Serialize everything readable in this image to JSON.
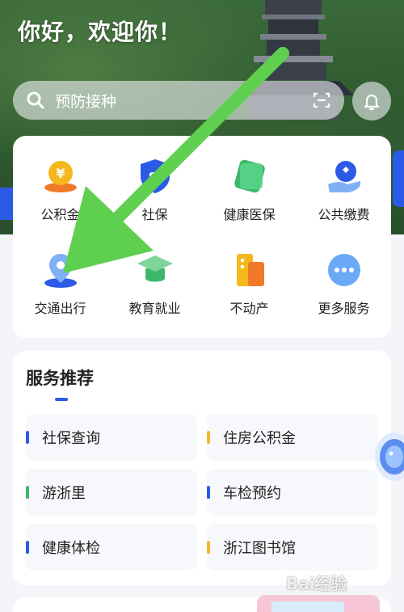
{
  "greeting": "你好，欢迎你！",
  "search": {
    "placeholder": "预防接种"
  },
  "services": [
    {
      "label": "公积金",
      "icon": "yuan-coin-icon"
    },
    {
      "label": "社保",
      "icon": "social-security-shield-icon"
    },
    {
      "label": "健康医保",
      "icon": "health-card-icon"
    },
    {
      "label": "公共缴费",
      "icon": "payment-hand-icon"
    },
    {
      "label": "交通出行",
      "icon": "location-pin-icon"
    },
    {
      "label": "教育就业",
      "icon": "graduation-cap-icon"
    },
    {
      "label": "不动产",
      "icon": "building-icon"
    },
    {
      "label": "更多服务",
      "icon": "more-dots-icon"
    }
  ],
  "recommended": {
    "title": "服务推荐",
    "items": [
      {
        "label": "社保查询",
        "color": "#2b5be6"
      },
      {
        "label": "住房公积金",
        "color": "#f2b536"
      },
      {
        "label": "游浙里",
        "color": "#3bb86b"
      },
      {
        "label": "车检预约",
        "color": "#2b5be6"
      },
      {
        "label": "健康体检",
        "color": "#2b5be6"
      },
      {
        "label": "浙江图书馆",
        "color": "#f2b536"
      }
    ]
  },
  "watermark": "Bai经验",
  "colors": {
    "accent": "#2b5be6",
    "arrow": "#5fcf4f"
  }
}
